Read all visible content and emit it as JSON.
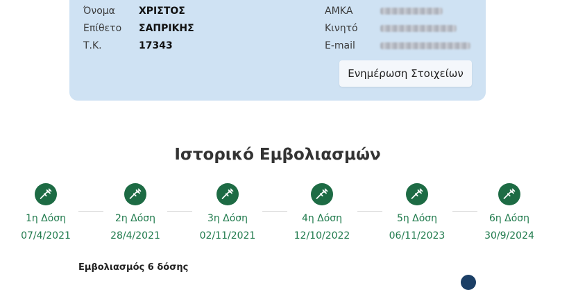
{
  "personal": {
    "name_label": "Όνομα",
    "name_value": "ΧΡΙΣΤΟΣ",
    "surname_label": "Επίθετο",
    "surname_value": "ΣΑΠΡΙΚΗΣ",
    "postal_label": "Τ.Κ.",
    "postal_value": "17343",
    "amka_label": "ΑΜΚΑ",
    "mobile_label": "Κινητό",
    "email_label": "E-mail",
    "update_button": "Ενημέρωση Στοιχείων"
  },
  "history": {
    "title": "Ιστορικό Εμβολιασμών",
    "doses": [
      {
        "label": "1η Δόση",
        "date": "07/4/2021"
      },
      {
        "label": "2η Δόση",
        "date": "28/4/2021"
      },
      {
        "label": "3η Δόση",
        "date": "02/11/2021"
      },
      {
        "label": "4η Δόση",
        "date": "12/10/2022"
      },
      {
        "label": "5η Δόση",
        "date": "06/11/2023"
      },
      {
        "label": "6η Δόση",
        "date": "30/9/2024"
      }
    ],
    "vaccination_label": "Εμβολιασμός 6 δόσης"
  },
  "colors": {
    "card_bg": "#cfe2f3",
    "dose_green": "#1d6b44",
    "dose_text": "#1f7a4c"
  },
  "icons": {
    "dose": "syringe-icon"
  }
}
